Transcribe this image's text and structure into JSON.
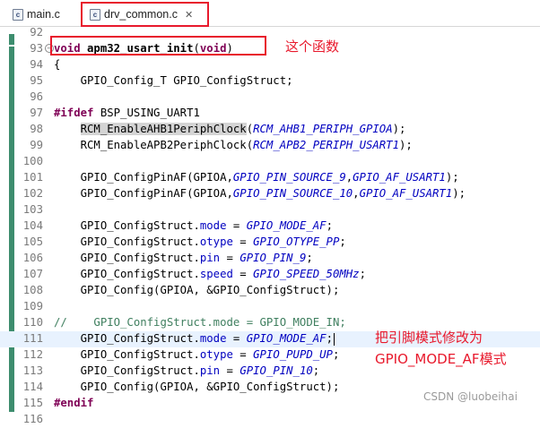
{
  "tabs": [
    {
      "label": "main.c",
      "icon": "c-file-icon"
    },
    {
      "label": "drv_common.c",
      "icon": "c-file-icon",
      "active": true
    }
  ],
  "close_glyph": "✕",
  "file_icon_text": "c",
  "fold_glyph": "−",
  "colors": {
    "highlight_red": "#e8192c",
    "keyword": "#7f0055",
    "constant": "#0000c0",
    "comment": "#3f7f5f",
    "ruler": "#3d8d6e"
  },
  "lines": [
    {
      "no": "92",
      "parts": []
    },
    {
      "no": "93",
      "fold": true,
      "parts": [
        [
          "kw",
          "void"
        ],
        [
          "p",
          " "
        ],
        [
          "fn",
          "apm32_usart_init"
        ],
        [
          "p",
          "("
        ],
        [
          "kw",
          "void"
        ],
        [
          "p",
          ")"
        ]
      ]
    },
    {
      "no": "94",
      "parts": [
        [
          "p",
          "{"
        ]
      ]
    },
    {
      "no": "95",
      "parts": [
        [
          "p",
          "    GPIO_Config_T GPIO_ConfigStruct;"
        ]
      ]
    },
    {
      "no": "96",
      "parts": []
    },
    {
      "no": "97",
      "parts": [
        [
          "kw",
          "#ifdef"
        ],
        [
          "p",
          " BSP_USING_UART1"
        ]
      ]
    },
    {
      "no": "98",
      "parts": [
        [
          "p",
          "    "
        ],
        [
          "hl",
          "RCM_EnableAHB1PeriphClock"
        ],
        [
          "p",
          "("
        ],
        [
          "cn",
          "RCM_AHB1_PERIPH_GPIOA"
        ],
        [
          "p",
          ");"
        ]
      ]
    },
    {
      "no": "99",
      "parts": [
        [
          "p",
          "    RCM_EnableAPB2PeriphClock("
        ],
        [
          "cn",
          "RCM_APB2_PERIPH_USART1"
        ],
        [
          "p",
          ");"
        ]
      ]
    },
    {
      "no": "100",
      "parts": []
    },
    {
      "no": "101",
      "parts": [
        [
          "p",
          "    GPIO_ConfigPinAF(GPIOA,"
        ],
        [
          "cn",
          "GPIO_PIN_SOURCE_9"
        ],
        [
          "p",
          ","
        ],
        [
          "cn",
          "GPIO_AF_USART1"
        ],
        [
          "p",
          ");"
        ]
      ]
    },
    {
      "no": "102",
      "parts": [
        [
          "p",
          "    GPIO_ConfigPinAF(GPIOA,"
        ],
        [
          "cn",
          "GPIO_PIN_SOURCE_10"
        ],
        [
          "p",
          ","
        ],
        [
          "cn",
          "GPIO_AF_USART1"
        ],
        [
          "p",
          ");"
        ]
      ]
    },
    {
      "no": "103",
      "parts": []
    },
    {
      "no": "104",
      "parts": [
        [
          "p",
          "    GPIO_ConfigStruct."
        ],
        [
          "fld",
          "mode"
        ],
        [
          "p",
          " = "
        ],
        [
          "cn",
          "GPIO_MODE_AF"
        ],
        [
          "p",
          ";"
        ]
      ]
    },
    {
      "no": "105",
      "parts": [
        [
          "p",
          "    GPIO_ConfigStruct."
        ],
        [
          "fld",
          "otype"
        ],
        [
          "p",
          " = "
        ],
        [
          "cn",
          "GPIO_OTYPE_PP"
        ],
        [
          "p",
          ";"
        ]
      ]
    },
    {
      "no": "106",
      "parts": [
        [
          "p",
          "    GPIO_ConfigStruct."
        ],
        [
          "fld",
          "pin"
        ],
        [
          "p",
          " = "
        ],
        [
          "cn",
          "GPIO_PIN_9"
        ],
        [
          "p",
          ";"
        ]
      ]
    },
    {
      "no": "107",
      "parts": [
        [
          "p",
          "    GPIO_ConfigStruct."
        ],
        [
          "fld",
          "speed"
        ],
        [
          "p",
          " = "
        ],
        [
          "cn",
          "GPIO_SPEED_50MHz"
        ],
        [
          "p",
          ";"
        ]
      ]
    },
    {
      "no": "108",
      "parts": [
        [
          "p",
          "    GPIO_Config(GPIOA, &GPIO_ConfigStruct);"
        ]
      ]
    },
    {
      "no": "109",
      "parts": []
    },
    {
      "no": "110",
      "parts": [
        [
          "cm",
          "//    GPIO_ConfigStruct.mode = GPIO_MODE_IN;"
        ]
      ]
    },
    {
      "no": "111",
      "current": true,
      "parts": [
        [
          "p",
          "    GPIO_ConfigStruct."
        ],
        [
          "fld",
          "mode"
        ],
        [
          "p",
          " = "
        ],
        [
          "cn",
          "GPIO_MODE_AF"
        ],
        [
          "p",
          ";"
        ]
      ]
    },
    {
      "no": "112",
      "parts": [
        [
          "p",
          "    GPIO_ConfigStruct."
        ],
        [
          "fld",
          "otype"
        ],
        [
          "p",
          " = "
        ],
        [
          "cn",
          "GPIO_PUPD_UP"
        ],
        [
          "p",
          ";"
        ]
      ]
    },
    {
      "no": "113",
      "parts": [
        [
          "p",
          "    GPIO_ConfigStruct."
        ],
        [
          "fld",
          "pin"
        ],
        [
          "p",
          " = "
        ],
        [
          "cn",
          "GPIO_PIN_10"
        ],
        [
          "p",
          ";"
        ]
      ]
    },
    {
      "no": "114",
      "parts": [
        [
          "p",
          "    GPIO_Config(GPIOA, &GPIO_ConfigStruct);"
        ]
      ]
    },
    {
      "no": "115",
      "parts": [
        [
          "kw",
          "#endif"
        ]
      ]
    },
    {
      "no": "116",
      "parts": []
    }
  ],
  "annotations": {
    "function_note": "这个函数",
    "pin_mode_note_line1": "把引脚模式修改为",
    "pin_mode_note_line2": "GPIO_MODE_AF模式"
  },
  "watermark": "CSDN @luobeihai"
}
